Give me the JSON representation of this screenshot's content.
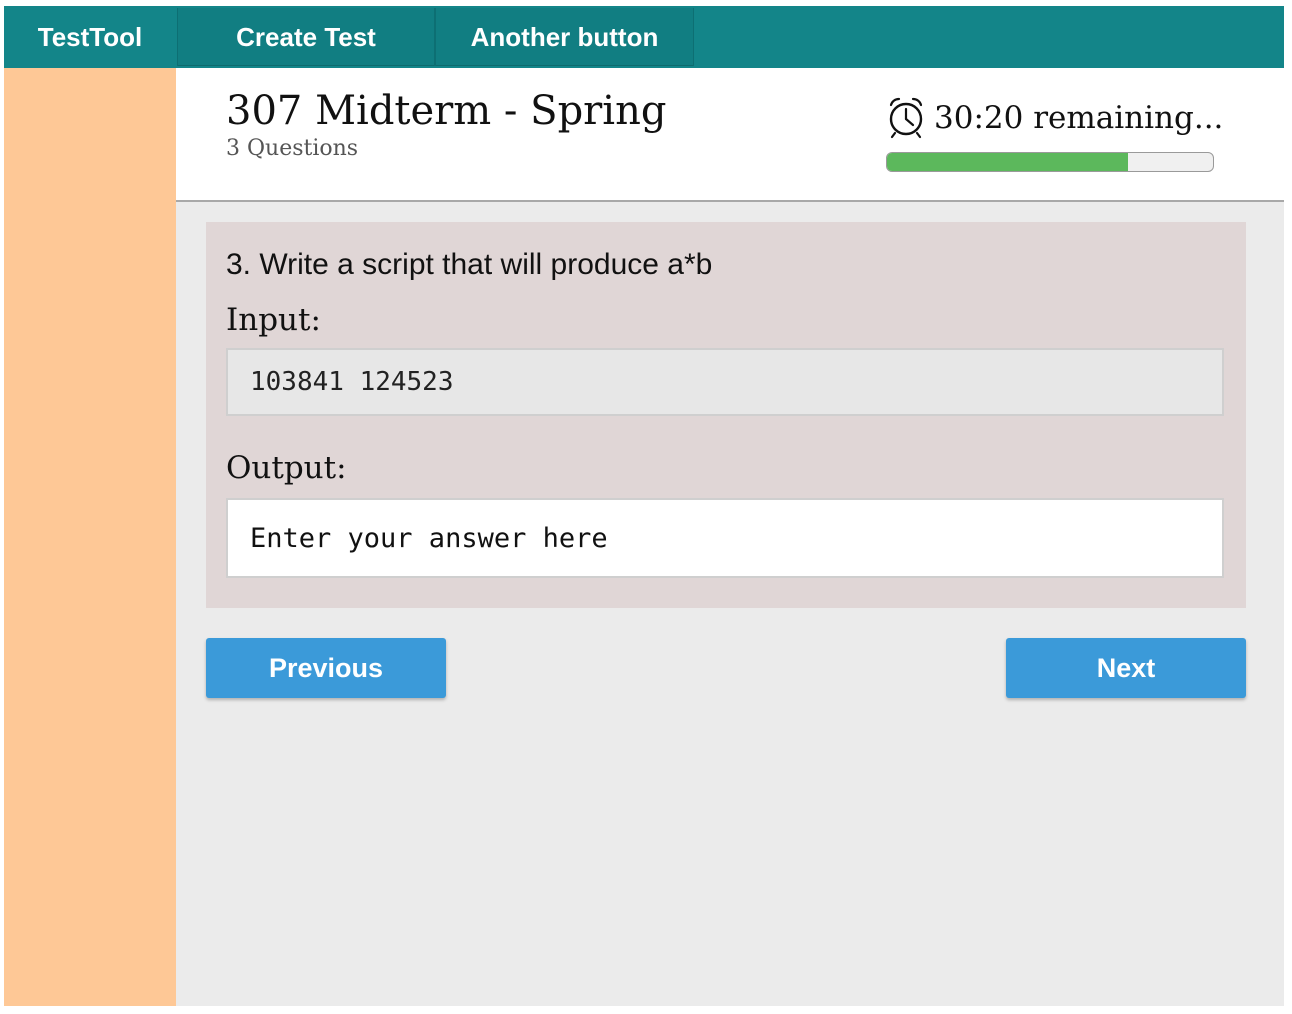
{
  "nav": {
    "brand": "TestTool",
    "create_test": "Create Test",
    "another_button": "Another button"
  },
  "header": {
    "title": "307 Midterm - Spring",
    "subtitle": "3 Questions",
    "timer_text": "30:20 remaining...",
    "timer_icon": "alarm-clock-icon",
    "progress_fraction": 0.74,
    "progress_color": "#5cb85c"
  },
  "question": {
    "text": "3. Write a script that will produce a*b",
    "input_label": "Input:",
    "input_value": "103841 124523",
    "output_label": "Output:",
    "output_placeholder": "Enter your answer here"
  },
  "buttons": {
    "previous": "Previous",
    "next": "Next"
  },
  "colors": {
    "nav_bg": "#138589",
    "sidebar_bg": "#fec896",
    "card_bg": "#e0d6d6",
    "button_bg": "#3b9ad9"
  }
}
